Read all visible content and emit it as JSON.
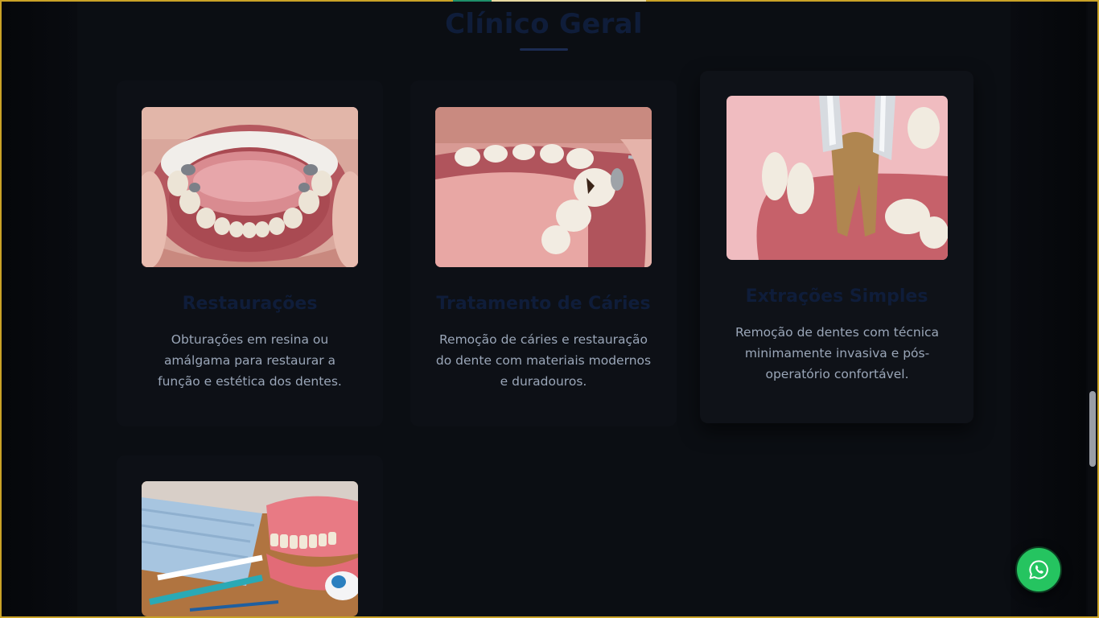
{
  "section": {
    "title": "Clínico Geral"
  },
  "cards": [
    {
      "title": "Restaurações",
      "description": "Obturações em resina ou amálgama para restaurar a função e estética dos dentes.",
      "image": "open-mouth-with-fillings-photo"
    },
    {
      "title": "Tratamento de Cáries",
      "description": "Remoção de cáries e restauração do dente com materiais modernos e duradouros.",
      "image": "caries-treatment-photo"
    },
    {
      "title": "Extrações Simples",
      "description": "Remoção de dentes com técnica minimamente invasiva e pós-operatório confortável.",
      "image": "tooth-extraction-illustration"
    },
    {
      "title": "",
      "description": "",
      "image": "dental-hygiene-items-photo"
    }
  ],
  "whatsapp": {
    "icon": "whatsapp-icon",
    "color": "#25c460"
  },
  "colors": {
    "page_background": "#0b0e13",
    "card_background": "#0d1016",
    "heading": "#0f1d3a",
    "body_text": "#9aa6b8",
    "frame_border": "#c9a227"
  }
}
